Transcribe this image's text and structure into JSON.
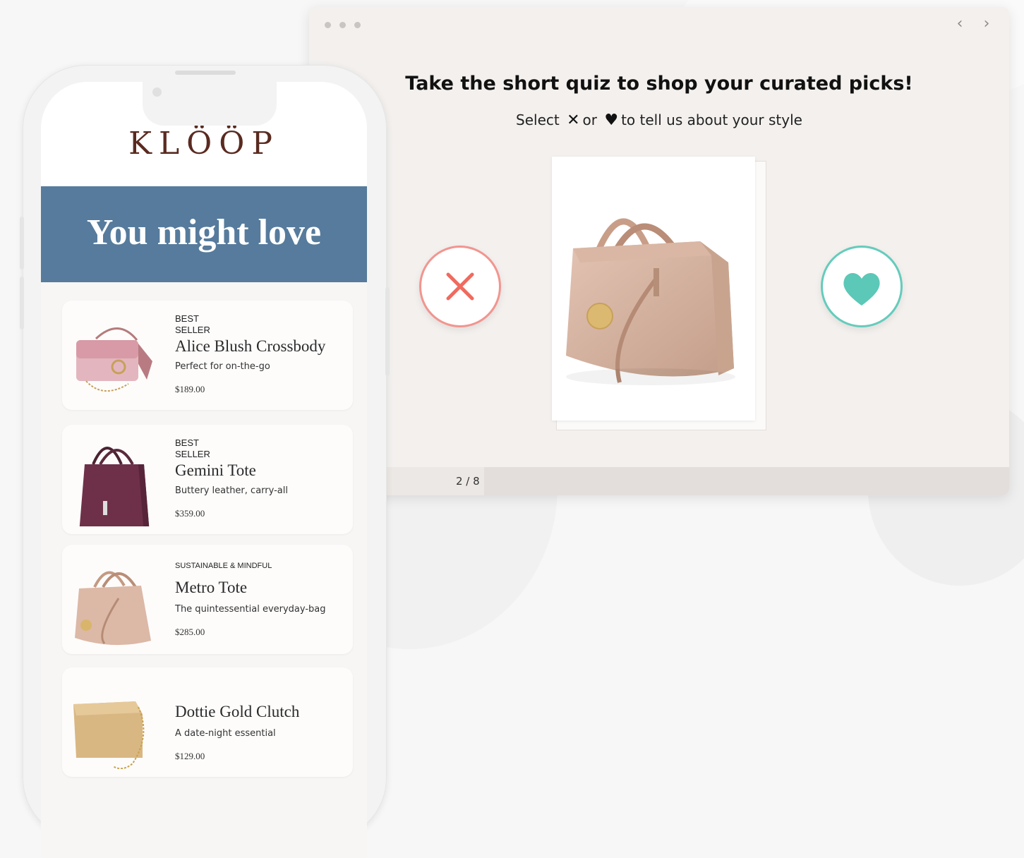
{
  "quiz": {
    "title": "Take the short quiz to shop your curated picks!",
    "subtitle_before": "Select",
    "subtitle_mid": "or",
    "subtitle_after": "to tell us about your style",
    "progress_label": "2 / 8",
    "progress_fraction": 0.25,
    "reject_color": "#f06a5e",
    "love_color": "#5cc8b7"
  },
  "nav": {
    "back": "‹",
    "forward": "›"
  },
  "brand": {
    "logo": "KLÖÖP",
    "banner": "You might love",
    "banner_color": "#567b9c"
  },
  "products": [
    {
      "badge": "BEST SELLER",
      "name": "Alice Blush Crossbody",
      "desc": "Perfect for on-the-go",
      "price": "$189.00"
    },
    {
      "badge": "BEST SELLER",
      "name": "Gemini Tote",
      "desc": "Buttery leather, carry-all",
      "price": "$359.00"
    },
    {
      "badge": "SUSTAINABLE & MINDFUL",
      "name": "Metro Tote",
      "desc": "The quintessential everyday-bag",
      "price": "$285.00"
    },
    {
      "badge": "",
      "name": "Dottie Gold Clutch",
      "desc": "A date-night essential",
      "price": "$129.00"
    }
  ]
}
